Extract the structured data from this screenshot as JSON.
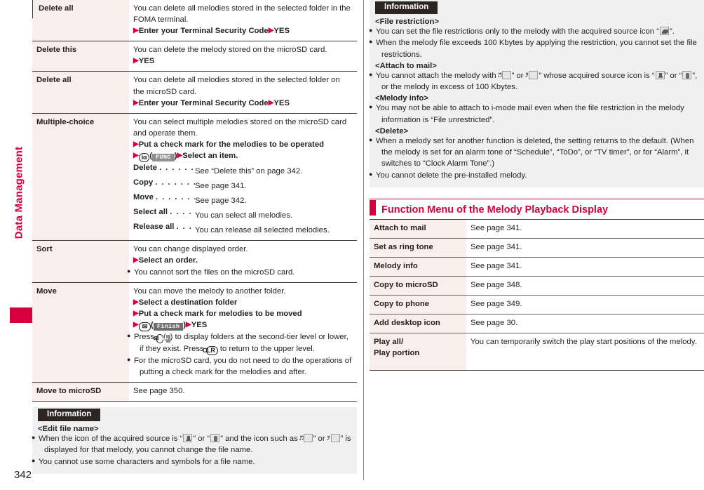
{
  "page": {
    "number": "342",
    "side_tab_label": "Data Management"
  },
  "left_column": {
    "table_rows": [
      {
        "term": "Delete all",
        "indented": true,
        "lines": [
          "You can delete all melodies stored in the selected folder in the FOMA terminal."
        ],
        "steps": [
          "Enter your Terminal Security Code",
          "YES"
        ],
        "step_mode": "inline"
      },
      {
        "term": "Delete this",
        "indented": false,
        "lines": [
          "You can delete the melody stored on the microSD card."
        ],
        "steps": [
          "YES"
        ]
      },
      {
        "term": "Delete all",
        "indented": false,
        "lines": [
          "You can delete all melodies stored in the selected folder on the microSD card."
        ],
        "steps": [
          "Enter your Terminal Security Code",
          "YES"
        ],
        "step_mode": "inline"
      },
      {
        "term": "Multiple-choice",
        "indented": false,
        "lines": [
          "You can select multiple melodies stored on the microSD card and operate them."
        ],
        "steps": [
          "Put a check mark for the melodies to be operated"
        ],
        "key_step": {
          "key": "i-alpha-key",
          "key_label": "iα",
          "softkey": "FUNC",
          "after": "Select an item."
        },
        "deflist": [
          {
            "term": "Delete",
            "dots": ". . . . . . .",
            "desc": "See “Delete this” on page 342."
          },
          {
            "term": "Copy",
            "dots": ". . . . . . . .",
            "desc": "See page 341."
          },
          {
            "term": "Move",
            "dots": ". . . . . . . .",
            "desc": "See page 342."
          },
          {
            "term": "Select all",
            "dots": ". . . . .",
            "desc": "You can select all melodies."
          },
          {
            "term": "Release all",
            "dots": ". . .",
            "desc": "You can release all selected melodies."
          }
        ]
      },
      {
        "term": "Sort",
        "indented": false,
        "lines": [
          "You can change displayed order."
        ],
        "steps": [
          "Select an order."
        ],
        "notes": [
          "You cannot sort the files on the microSD card."
        ]
      },
      {
        "term": "Move",
        "indented": false,
        "lines": [
          "You can move the melody to another folder."
        ],
        "steps": [
          "Select a destination folder",
          "Put a check mark for melodies to be moved"
        ],
        "key_step2": {
          "key_label": "mail-key",
          "softkey": "Finish",
          "after": "YES"
        },
        "notes_rich": [
          {
            "pre": "Press ",
            "key": "mail-key",
            "softkey": "folder-up",
            "post": ") to display folders at the second-tier level or lower, if they exist. Press ",
            "key2": "CLR",
            "post2": " to return to the upper level."
          }
        ],
        "notes": [
          "For the microSD card, you do not need to do the operations of putting a check mark for the melodies and after."
        ]
      },
      {
        "term": "Move to microSD",
        "indented": false,
        "lines": [
          "See page 350."
        ]
      }
    ],
    "information": {
      "badge": "Information",
      "blocks": [
        {
          "heading": "<Edit file name>",
          "items_rich": [
            {
              "parts": [
                "When the icon of the acquired source is “",
                "ICON:src-pc",
                "” or “",
                "ICON:src-server",
                "” and the icon such as “",
                "ICON:note2",
                "” or “",
                "ICON:note1",
                "” is displayed for that melody, you cannot change the file name."
              ]
            },
            {
              "parts": [
                "You cannot use some characters and symbols for a file name."
              ]
            }
          ]
        }
      ]
    }
  },
  "right_column": {
    "information": {
      "badge": "Information",
      "blocks": [
        {
          "heading": "<File restriction>",
          "items_rich": [
            {
              "parts": [
                "You can set the file restrictions only to the melody with the acquired source icon “",
                "ICON:net",
                "”."
              ]
            },
            {
              "parts": [
                "When the melody file exceeds 100 Kbytes by applying the restriction, you cannot set the file restrictions."
              ]
            }
          ]
        },
        {
          "heading": "<Attach to mail>",
          "items_rich": [
            {
              "parts": [
                "You cannot attach the melody with “",
                "ICON:note2",
                "” or “",
                "ICON:note1",
                "” whose acquired source icon is “",
                "ICON:src-pc",
                "” or “",
                "ICON:src-server",
                "”, or the melody in excess of 100 Kbytes."
              ]
            }
          ]
        },
        {
          "heading": "<Melody info>",
          "items_rich": [
            {
              "parts": [
                "You may not be able to attach to i-mode mail even when the file restriction in the melody information is “File unrestricted”."
              ]
            }
          ]
        },
        {
          "heading": "<Delete>",
          "items_rich": [
            {
              "parts": [
                "When a melody set for another function is deleted, the setting returns to the default. (When the melody is set for an alarm tone of “Schedule”, “ToDo”, or “TV timer”, or for “Alarm”, it switches to “Clock Alarm Tone”.)"
              ]
            },
            {
              "parts": [
                "You cannot delete the pre-installed melody."
              ]
            }
          ]
        }
      ]
    },
    "section": {
      "title": "Function Menu of the Melody Playback Display",
      "table_rows": [
        {
          "term": "Attach to mail",
          "desc": "See page 341."
        },
        {
          "term": "Set as ring tone",
          "desc": "See page 341."
        },
        {
          "term": "Melody info",
          "desc": "See page 341."
        },
        {
          "term": "Copy to microSD",
          "desc": "See page 348."
        },
        {
          "term": "Copy to phone",
          "desc": "See page 349."
        },
        {
          "term": "Add desktop icon",
          "desc": "See page 30."
        },
        {
          "term": "Play all/\nPlay portion",
          "term_line1": "Play all/",
          "term_line2": "Play portion",
          "desc": "You can temporarily switch the play start positions of the melody."
        }
      ]
    }
  },
  "colors": {
    "accent": "#d6003c",
    "term_bg": "#faeeea",
    "info_bg": "#f0f0f0",
    "badge_bg": "#2c2522",
    "rule": "#3a3331"
  }
}
